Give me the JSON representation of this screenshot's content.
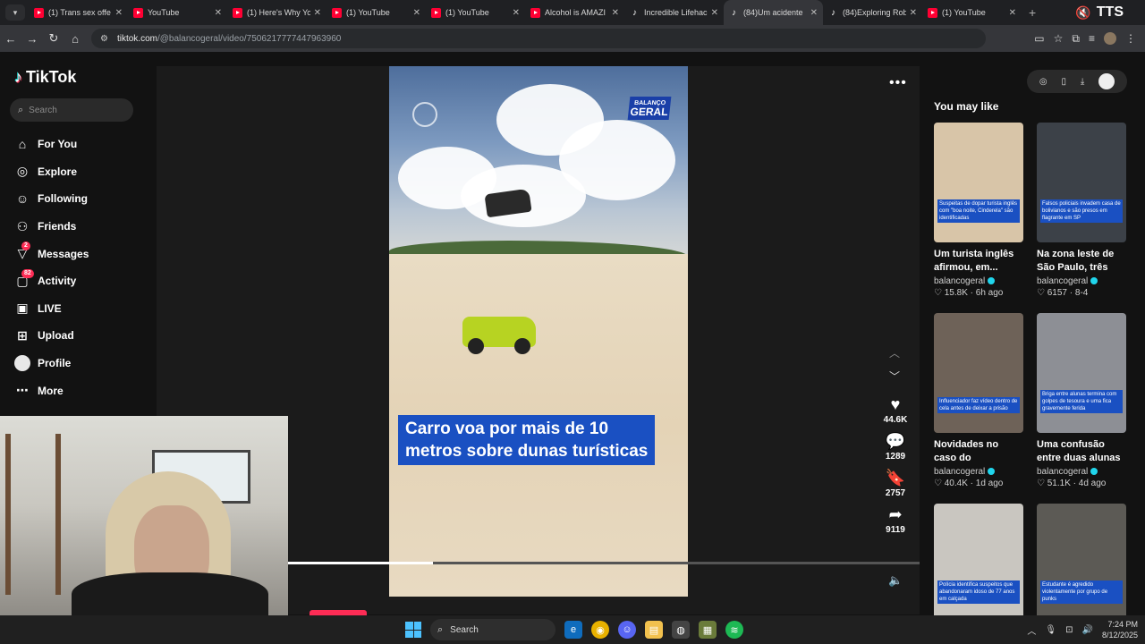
{
  "browser": {
    "tabs": [
      {
        "title": "(1) Trans sex offe",
        "icon": "youtube-icon",
        "active": false
      },
      {
        "title": "YouTube",
        "icon": "youtube-icon",
        "active": false
      },
      {
        "title": "(1) Here's Why Yo",
        "icon": "youtube-icon",
        "active": false
      },
      {
        "title": "(1) YouTube",
        "icon": "youtube-icon",
        "active": false
      },
      {
        "title": "(1) YouTube",
        "icon": "youtube-icon",
        "active": false
      },
      {
        "title": "Alcohol is AMAZI",
        "icon": "youtube-icon",
        "active": false
      },
      {
        "title": "Incredible Lifehac",
        "icon": "tiktok-icon",
        "active": false
      },
      {
        "title": "(84)Um acidente",
        "icon": "tiktok-icon",
        "active": true
      },
      {
        "title": "(84)Exploring Rob",
        "icon": "tiktok-icon",
        "active": false
      },
      {
        "title": "(1) YouTube",
        "icon": "youtube-icon",
        "active": false
      }
    ],
    "tts_label": "TTS",
    "url_host": "tiktok.com",
    "url_path": "/@balancogeral/video/7506217777447963960"
  },
  "sidebar": {
    "logo": "TikTok",
    "search_placeholder": "Search",
    "items": [
      {
        "label": "For You",
        "icon": "home-icon"
      },
      {
        "label": "Explore",
        "icon": "compass-icon"
      },
      {
        "label": "Following",
        "icon": "following-icon"
      },
      {
        "label": "Friends",
        "icon": "friends-icon"
      },
      {
        "label": "Messages",
        "icon": "messages-icon",
        "badge": "2"
      },
      {
        "label": "Activity",
        "icon": "activity-icon",
        "badge": "82"
      },
      {
        "label": "LIVE",
        "icon": "live-icon"
      },
      {
        "label": "Upload",
        "icon": "upload-icon"
      },
      {
        "label": "Profile",
        "icon": "profile-icon"
      },
      {
        "label": "More",
        "icon": "more-icon"
      }
    ]
  },
  "video": {
    "brand_line1": "BALANÇO",
    "brand_line2": "GERAL",
    "caption_line1": "Carro voa por mais de 10",
    "caption_line2": "metros sobre dunas turísticas",
    "progress": 0.23
  },
  "actions": {
    "likes": "44.6K",
    "comments": "1289",
    "saves": "2757",
    "shares": "9119"
  },
  "recommendations": {
    "heading": "You may like",
    "items": [
      {
        "thumb_caption": "Suspeitas de dopar turista inglês com \"boa noite, Cinderela\" são identificadas",
        "title": "Um turista inglês afirmou, em...",
        "author": "balancogeral",
        "likes": "15.8K",
        "age": "6h ago",
        "thumb_color": "#d8c5a8"
      },
      {
        "thumb_caption": "Falsos policiais invadem casa de bolivianos e são presos em flagrante em SP",
        "title": "Na zona leste de São Paulo, três homens...",
        "author": "balancogeral",
        "likes": "6157",
        "age": "8-4",
        "thumb_color": "#3c4148"
      },
      {
        "thumb_caption": "Influenciador faz vídeo dentro de cela antes de deixar a prisão",
        "title": "Novidades no caso do influenciador...",
        "author": "balancogeral",
        "likes": "40.4K",
        "age": "1d ago",
        "thumb_color": "#6e6258"
      },
      {
        "thumb_caption": "Briga entre alunas termina com golpes de tesoura e uma fica gravemente ferida",
        "title": "Uma confusão entre duas alunas dentro...",
        "author": "balancogeral",
        "likes": "51.1K",
        "age": "4d ago",
        "thumb_color": "#8d8f95"
      },
      {
        "thumb_caption": "Polícia identifica suspeitos que abandonaram idoso de 77 anos em calçada",
        "title": "",
        "author": "",
        "likes": "",
        "age": "",
        "thumb_color": "#c9c6c0"
      },
      {
        "thumb_caption": "Estudante é agredido violentamente por grupo de punks",
        "title": "",
        "author": "",
        "likes": "",
        "age": "",
        "thumb_color": "#5c5a55"
      }
    ]
  },
  "taskbar": {
    "search_label": "Search",
    "time": "7:24 PM",
    "date": "8/12/2025"
  }
}
